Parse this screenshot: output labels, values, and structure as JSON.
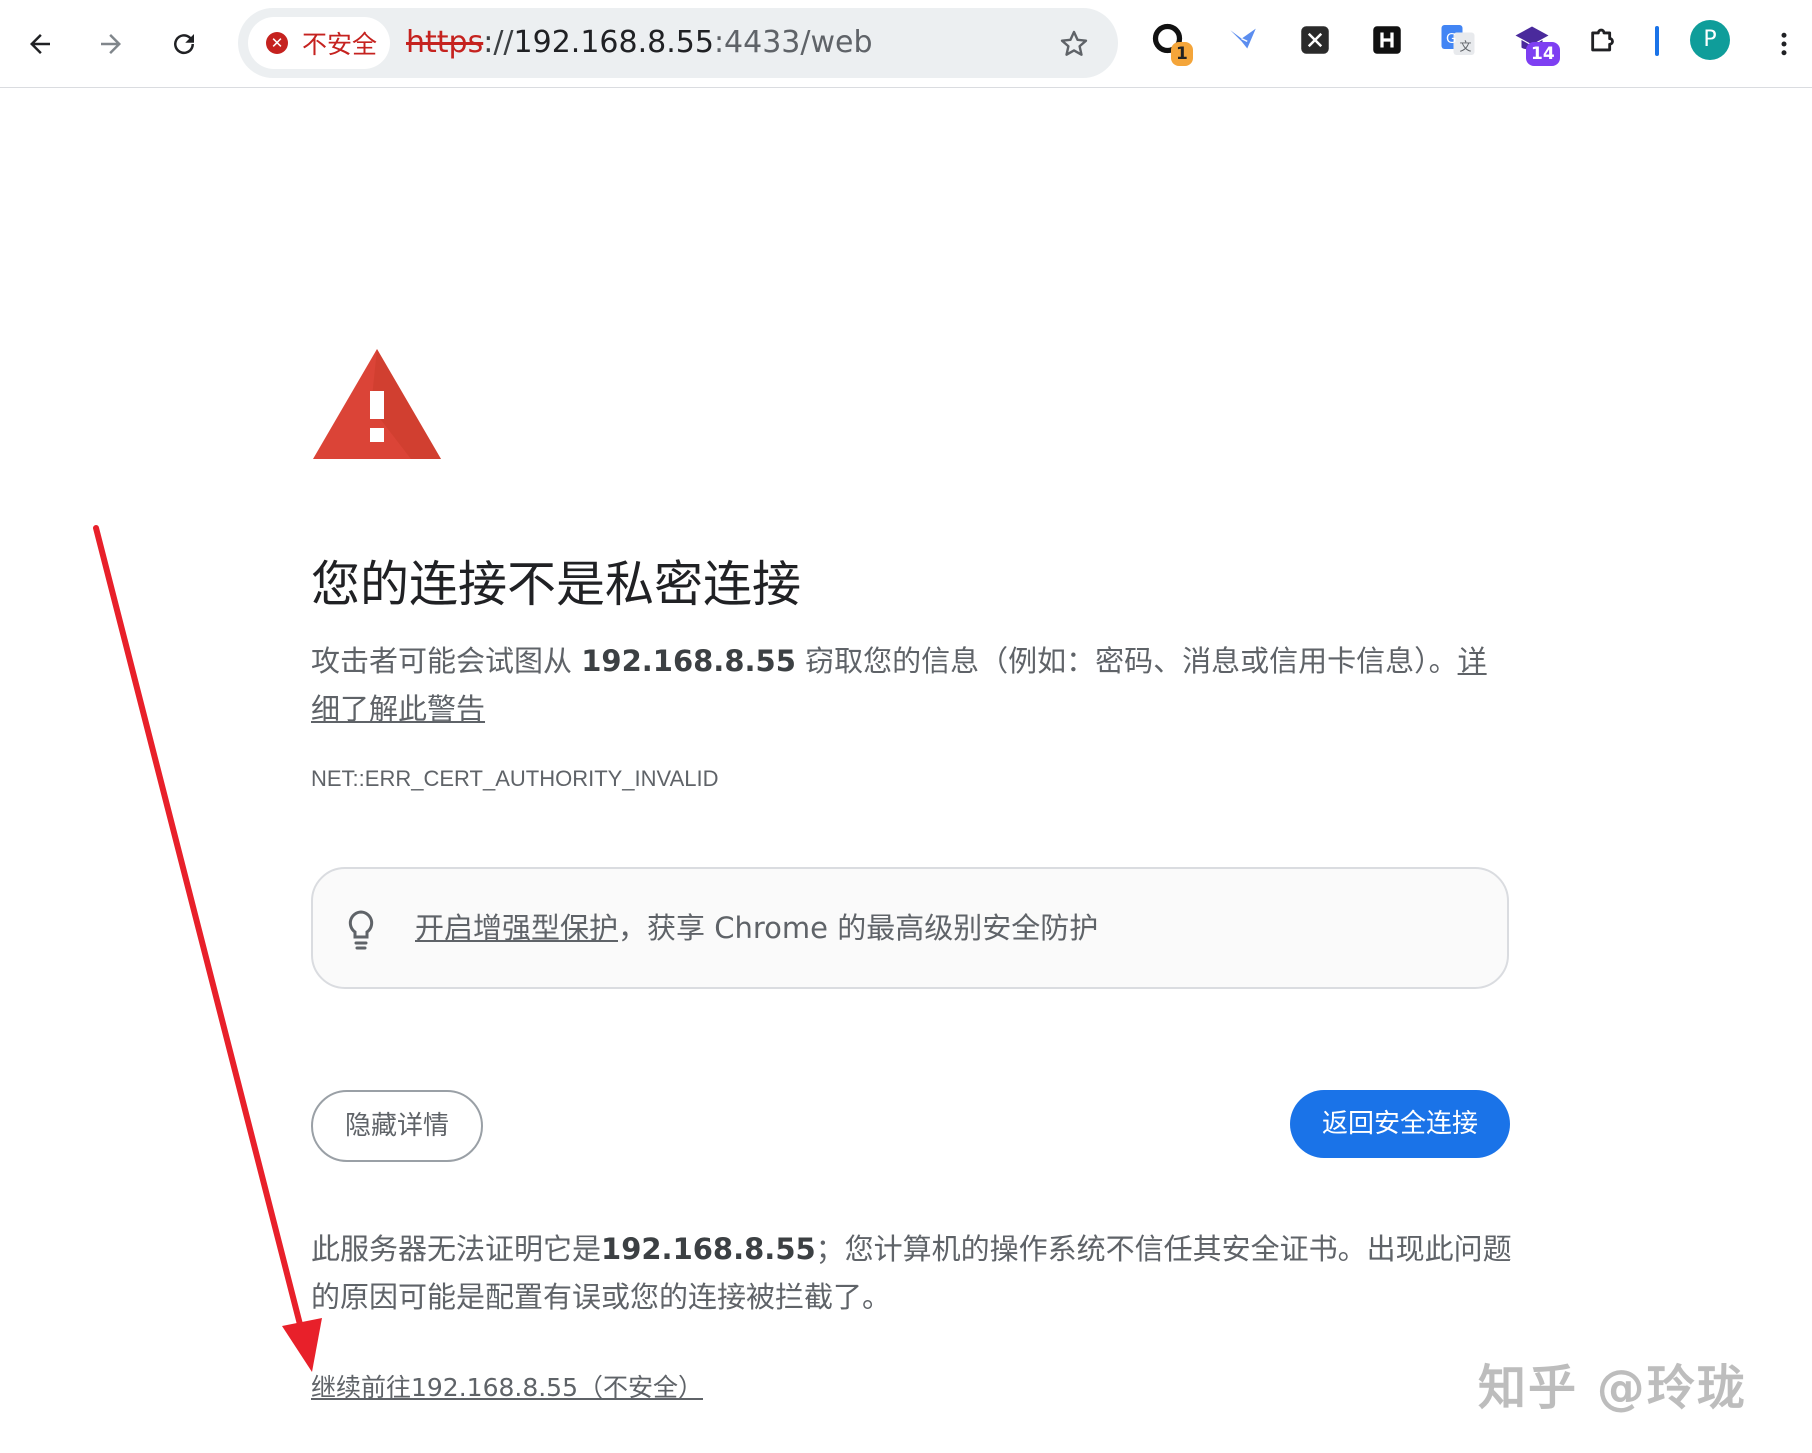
{
  "browser": {
    "security_chip": "不安全",
    "url_scheme": "https",
    "url_sep": "://",
    "url_host": "192.168.8.55",
    "url_port_path": ":4433/web",
    "extensions": [
      {
        "name": "extension-1",
        "badge": "1",
        "badge_color": "#f4a53a"
      },
      {
        "name": "extension-2"
      },
      {
        "name": "extension-3"
      },
      {
        "name": "extension-4"
      },
      {
        "name": "extension-5"
      },
      {
        "name": "extension-6",
        "badge": "14",
        "badge_color": "#7e3ff2"
      }
    ],
    "profile_initial": "P"
  },
  "interstitial": {
    "heading": "您的连接不是私密连接",
    "explanation_prefix": "攻击者可能会试图从 ",
    "explanation_host": "192.168.8.55",
    "explanation_suffix": " 窃取您的信息（例如：密码、消息或信用卡信息）。",
    "learn_more_link": "详细了解此警告",
    "error_code": "NET::ERR_CERT_AUTHORITY_INVALID",
    "promo_link": "开启增强型保护",
    "promo_suffix": "，获享 Chrome 的最高级别安全防护",
    "hide_details_button": "隐藏详情",
    "back_to_safety_button": "返回安全连接",
    "details_prefix": "此服务器无法证明它是",
    "details_host": "192.168.8.55",
    "details_suffix": "；您计算机的操作系统不信任其安全证书。出现此问题的原因可能是配置有误或您的连接被拦截了。",
    "proceed_link": "继续前往192.168.8.55（不安全）"
  },
  "watermark": "知乎 @玲珑",
  "colors": {
    "danger": "#c5221f",
    "primary": "#1a73e8",
    "warning_triangle": "#db4437",
    "annotation_arrow": "#e8202a"
  }
}
